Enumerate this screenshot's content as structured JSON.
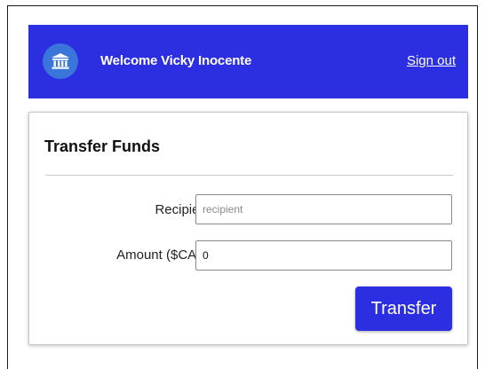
{
  "header": {
    "logo_icon": "bank-icon",
    "welcome_text": "Welcome Vicky Inocente",
    "signout_label": "Sign out",
    "background_color": "#2b2fe1",
    "logo_color": "#3a76d9"
  },
  "transfer": {
    "title": "Transfer Funds",
    "recipient_label": "Recipient",
    "recipient_placeholder": "recipient",
    "recipient_value": "",
    "amount_label": "Amount ($CAD)",
    "amount_value": "0",
    "submit_label": "Transfer"
  }
}
